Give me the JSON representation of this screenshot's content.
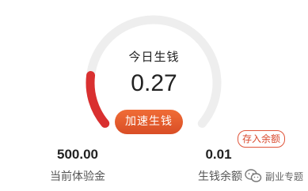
{
  "gauge": {
    "title": "今日生钱",
    "value": "0.27",
    "progress": 0.18,
    "track_color": "#eeeeee",
    "fill_color": "#d93030"
  },
  "actions": {
    "boost_label": "加速生钱",
    "deposit_label": "存入余额"
  },
  "stats": {
    "trial_amount": {
      "value": "500.00",
      "label": "当前体验金"
    },
    "balance": {
      "value": "0.01",
      "label": "生钱余额"
    }
  },
  "watermark": {
    "icon": "wechat-icon",
    "text": "副业专题"
  },
  "colors": {
    "accent": "#e0553a",
    "button_gradient_top": "#f06c36",
    "button_gradient_bottom": "#d94e26"
  }
}
